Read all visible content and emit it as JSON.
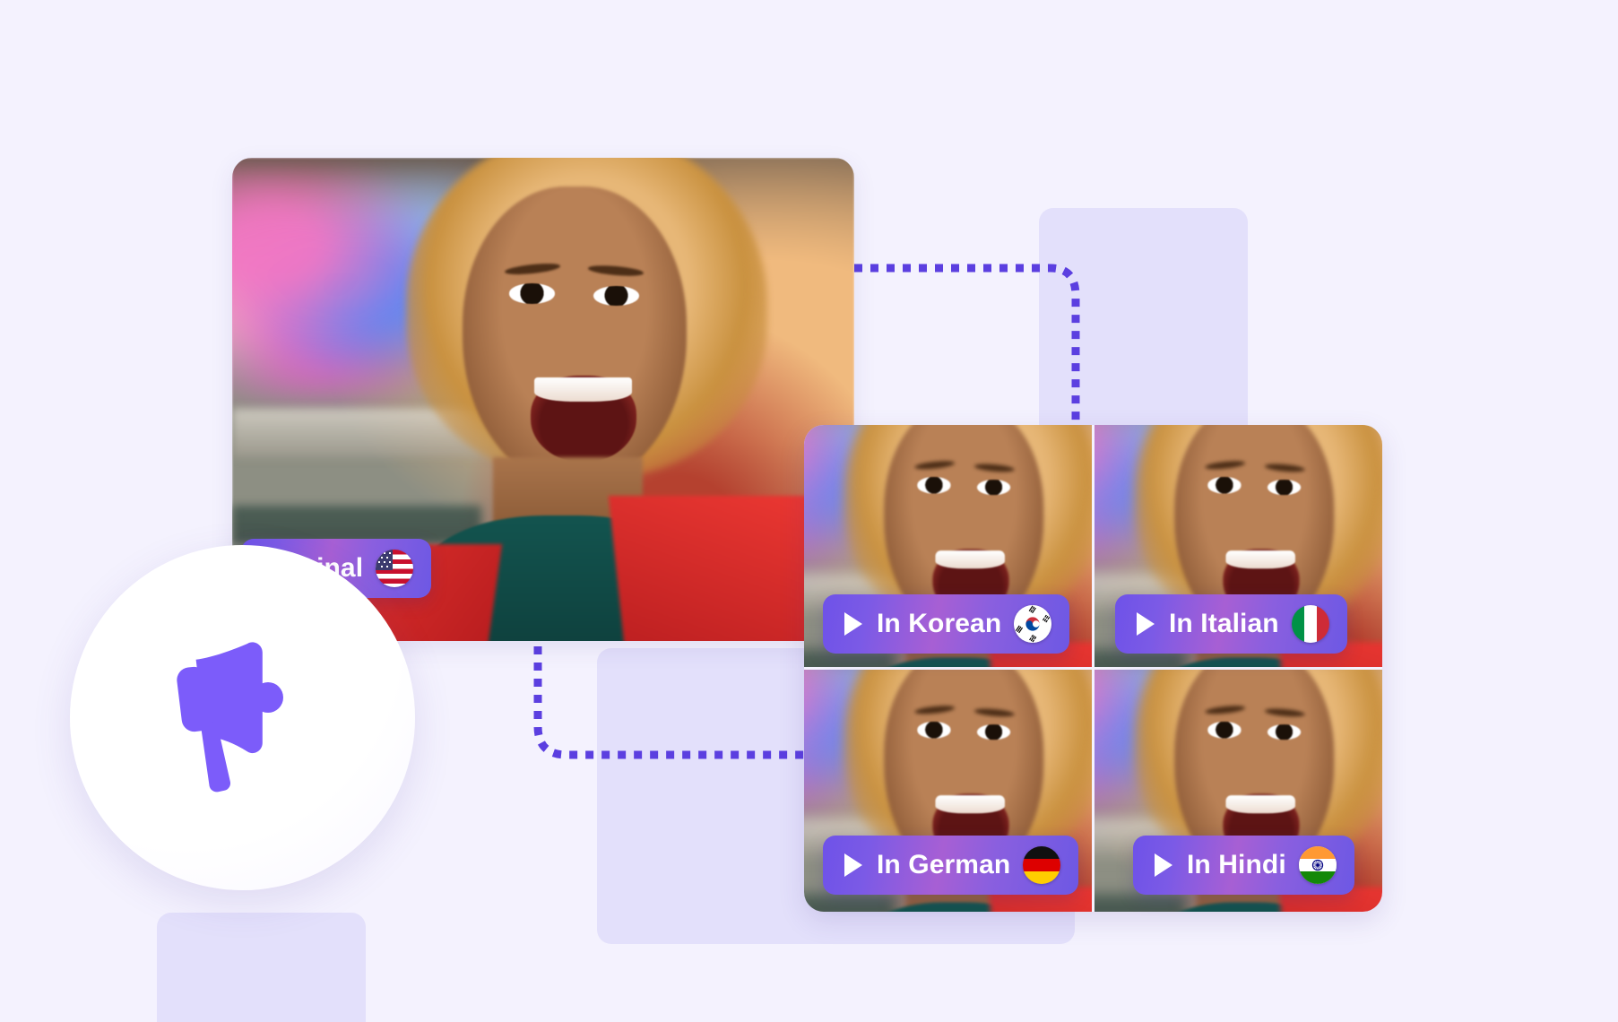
{
  "background": {
    "page_color": "#f4f2fe",
    "block_color": "#e3e0fb",
    "accent_color": "#5b3fe0",
    "badge_gradient_from": "#6e52e8",
    "badge_gradient_to": "#a75fd4",
    "megaphone_color": "#7c5cfa"
  },
  "icons": {
    "megaphone": "megaphone-icon",
    "play": "play-icon"
  },
  "original_video": {
    "badge": {
      "label": "Original",
      "flag": "us-flag-icon",
      "flag_name": "United States"
    }
  },
  "translated_videos": [
    {
      "id": "korean",
      "badge_label": "In Korean",
      "flag": "kr-flag-icon",
      "flag_name": "South Korea",
      "has_play_icon": true
    },
    {
      "id": "italian",
      "badge_label": "In Italian",
      "flag": "it-flag-icon",
      "flag_name": "Italy",
      "has_play_icon": true
    },
    {
      "id": "german",
      "badge_label": "In German",
      "flag": "de-flag-icon",
      "flag_name": "Germany",
      "has_play_icon": true
    },
    {
      "id": "hindi",
      "badge_label": "In Hindi",
      "flag": "in-flag-icon",
      "flag_name": "India",
      "has_play_icon": true
    }
  ]
}
